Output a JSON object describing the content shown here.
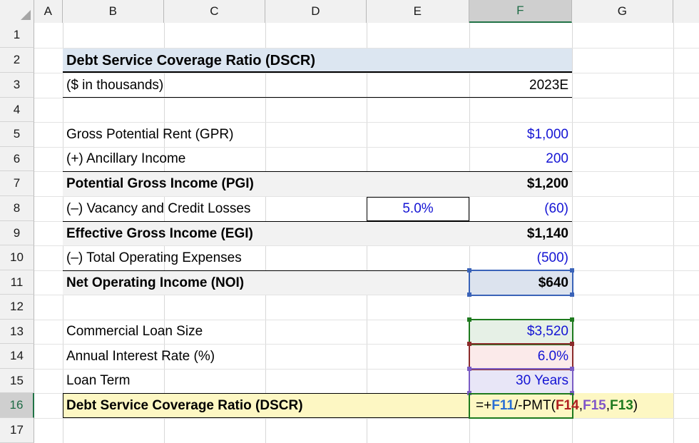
{
  "app": {
    "type": "spreadsheet"
  },
  "grid": {
    "column_headers": [
      "A",
      "B",
      "C",
      "D",
      "E",
      "F",
      "G"
    ],
    "selected_column": "F",
    "row_headers": [
      "1",
      "2",
      "3",
      "4",
      "5",
      "6",
      "7",
      "8",
      "9",
      "10",
      "11",
      "12",
      "13",
      "14",
      "15",
      "16",
      "17"
    ],
    "selected_row": "16"
  },
  "colors": {
    "title_fill": "#dce6f1",
    "subtotal_fill": "#f2f2f2",
    "edit_fill": "#fdf7c3",
    "blue_text": "#1414d4",
    "loan_size_fill": "#e6f0e6",
    "loan_size_border": "#1e7a1e",
    "rate_fill": "#fbeaea",
    "rate_border": "#8b2b2b",
    "term_fill": "#e8e6f7",
    "term_border": "#7a5cc4",
    "noi_fill": "#dce3ee",
    "noi_border": "#3a63b8",
    "edit_border": "#1e7a1e",
    "excel_green": "#217346"
  },
  "sheet": {
    "title": "Debt Service Coverage Ratio (DSCR)",
    "units_label": "($ in thousands)",
    "period_header": "2023E",
    "rows": [
      {
        "row": "5",
        "label": "Gross Potential Rent (GPR)",
        "value": "$1,000"
      },
      {
        "row": "6",
        "label": "(+) Ancillary Income",
        "value": "200"
      },
      {
        "row": "7",
        "label": "Potential Gross Income (PGI)",
        "value": "$1,200"
      },
      {
        "row": "8",
        "label": "(–) Vacancy and Credit Losses",
        "assumption": "5.0%",
        "value": "(60)"
      },
      {
        "row": "9",
        "label": "Effective Gross Income (EGI)",
        "value": "$1,140"
      },
      {
        "row": "10",
        "label": "(–) Total Operating Expenses",
        "value": "(500)"
      },
      {
        "row": "11",
        "label": "Net Operating Income (NOI)",
        "value": "$640"
      },
      {
        "row": "13",
        "label": "Commercial Loan Size",
        "value": "$3,520"
      },
      {
        "row": "14",
        "label": "Annual Interest Rate (%)",
        "value": "6.0%"
      },
      {
        "row": "15",
        "label": "Loan Term",
        "value": "30 Years"
      },
      {
        "row": "16",
        "label": "Debt Service Coverage Ratio (DSCR)"
      }
    ]
  },
  "formula": {
    "cell": "F16",
    "tokens": [
      {
        "text": "=+",
        "color": "#000000"
      },
      {
        "text": "F11",
        "color": "#2a6fd4"
      },
      {
        "text": "/-PMT(",
        "color": "#000000"
      },
      {
        "text": "F14",
        "color": "#b02020"
      },
      {
        "text": ",",
        "color": "#000000"
      },
      {
        "text": "F15",
        "color": "#8055c8"
      },
      {
        "text": ",",
        "color": "#000000"
      },
      {
        "text": "F13",
        "color": "#1e7a1e"
      },
      {
        "text": ")",
        "color": "#000000"
      }
    ]
  }
}
